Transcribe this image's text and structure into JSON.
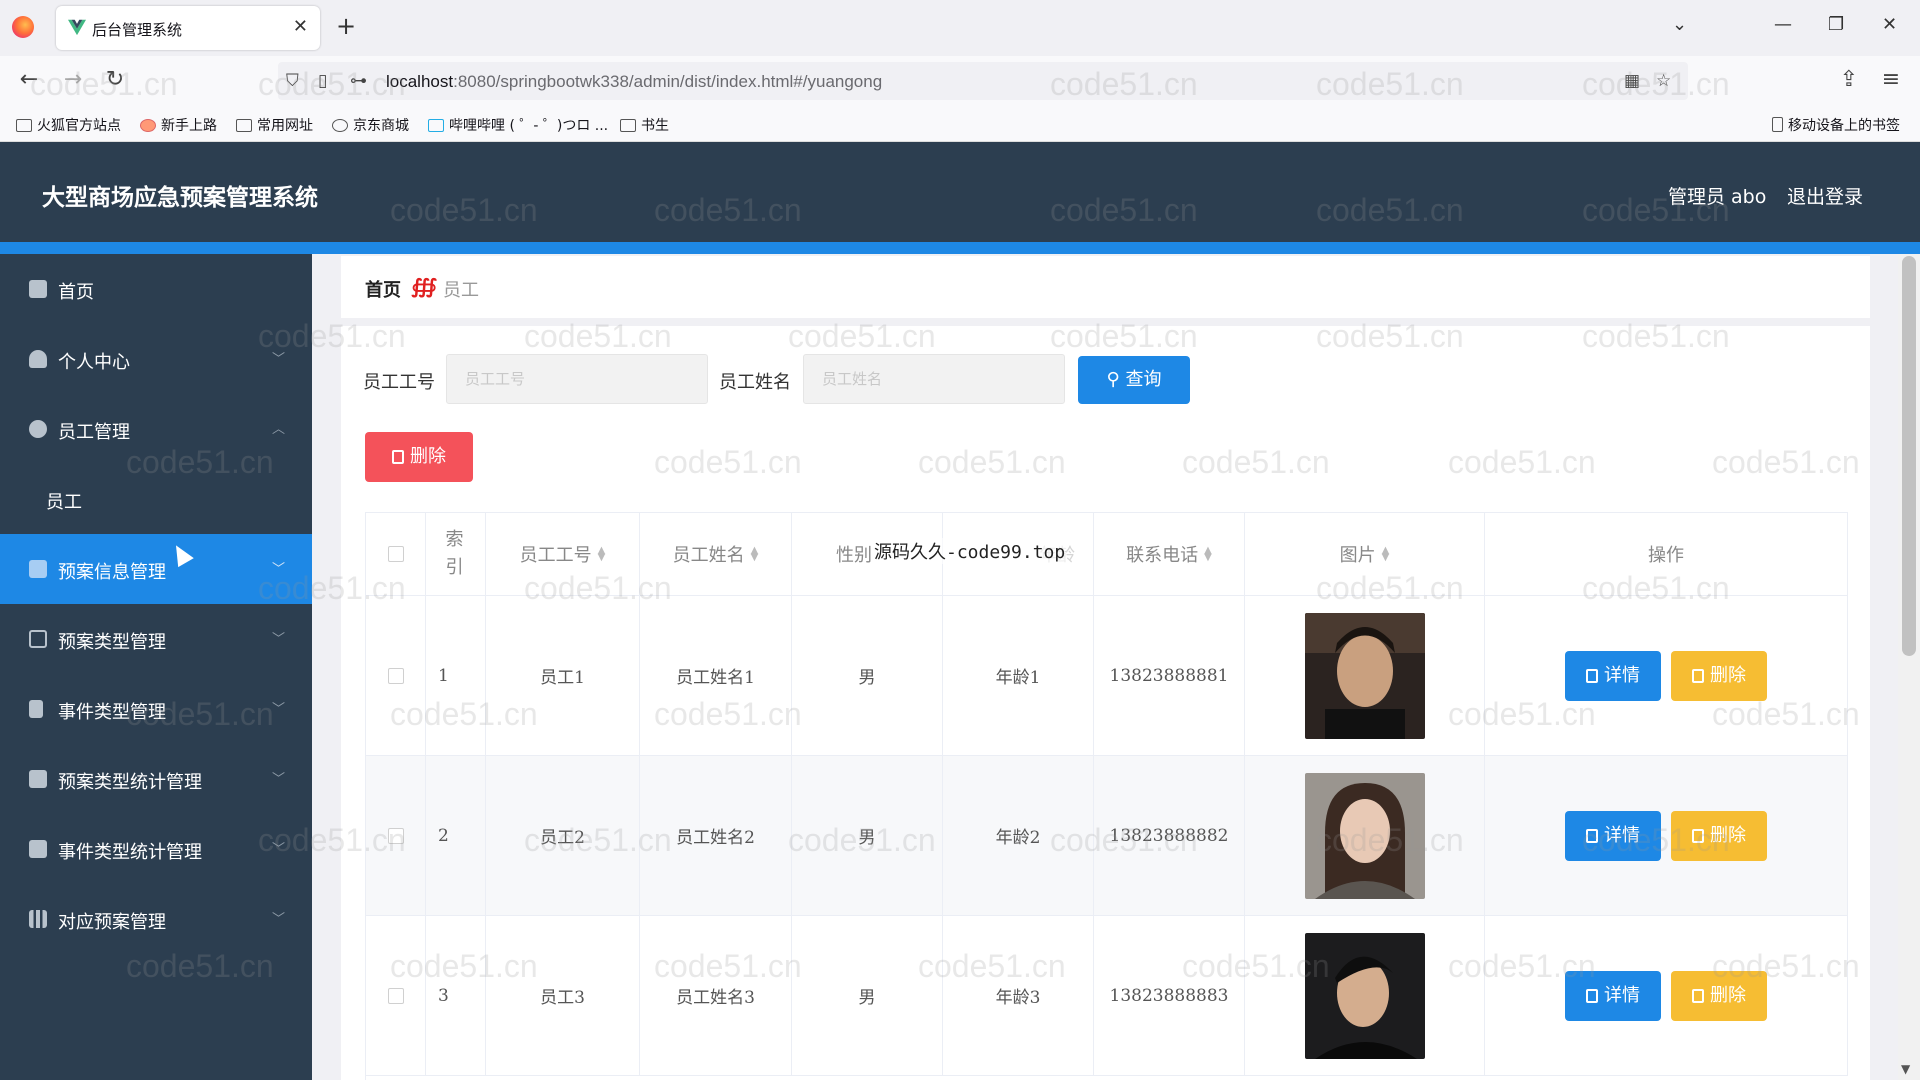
{
  "browser": {
    "tab_title": "后台管理系统",
    "url_host": "localhost",
    "url_rest": ":8080/springbootwk338/admin/dist/index.html#/yuangong",
    "bookmarks": [
      "火狐官方站点",
      "新手上路",
      "常用网址",
      "京东商城",
      "哔哩哔哩 ( ゜- ゜)つロ ...",
      "书生"
    ],
    "mobile_bookmarks": "移动设备上的书签"
  },
  "header": {
    "title": "大型商场应急预案管理系统",
    "user": "管理员 abo",
    "logout": "退出登录"
  },
  "sidebar": {
    "items": [
      {
        "label": "首页",
        "icon": "home-icon"
      },
      {
        "label": "个人中心",
        "icon": "user-icon"
      },
      {
        "label": "员工管理",
        "icon": "location-icon"
      },
      {
        "label": "预案信息管理",
        "icon": "monitor-icon"
      },
      {
        "label": "预案类型管理",
        "icon": "list-icon"
      },
      {
        "label": "事件类型管理",
        "icon": "flag-icon"
      },
      {
        "label": "预案类型统计管理",
        "icon": "monitor-icon"
      },
      {
        "label": "事件类型统计管理",
        "icon": "clipboard-icon"
      },
      {
        "label": "对应预案管理",
        "icon": "bar-chart-icon"
      }
    ],
    "submenu_employee": "员工"
  },
  "breadcrumb": {
    "home": "首页",
    "current": "员工"
  },
  "search": {
    "label_id": "员工工号",
    "placeholder_id": "员工工号",
    "label_name": "员工姓名",
    "placeholder_name": "员工姓名",
    "query_button": "查询"
  },
  "actions": {
    "delete_button": "删除"
  },
  "table": {
    "headers": {
      "index": "索引",
      "emp_id": "员工工号",
      "emp_name": "员工姓名",
      "gender": "性别",
      "age": "年龄",
      "phone": "联系电话",
      "photo": "图片",
      "ops": "操作"
    },
    "rows": [
      {
        "index": "1",
        "emp_id": "员工1",
        "emp_name": "员工姓名1",
        "gender": "男",
        "age": "年龄1",
        "phone": "13823888881"
      },
      {
        "index": "2",
        "emp_id": "员工2",
        "emp_name": "员工姓名2",
        "gender": "男",
        "age": "年龄2",
        "phone": "13823888882"
      },
      {
        "index": "3",
        "emp_id": "员工3",
        "emp_name": "员工姓名3",
        "gender": "男",
        "age": "年龄3",
        "phone": "13823888883"
      }
    ],
    "detail_button": "详情",
    "row_delete_button": "删除"
  },
  "watermark": {
    "text": "code51.cn",
    "center_text": "源码久久-code99.top"
  },
  "colors": {
    "header_bg": "#2c3e50",
    "accent": "#1e88e5",
    "danger": "#f4525a",
    "warning": "#f6bd33"
  }
}
